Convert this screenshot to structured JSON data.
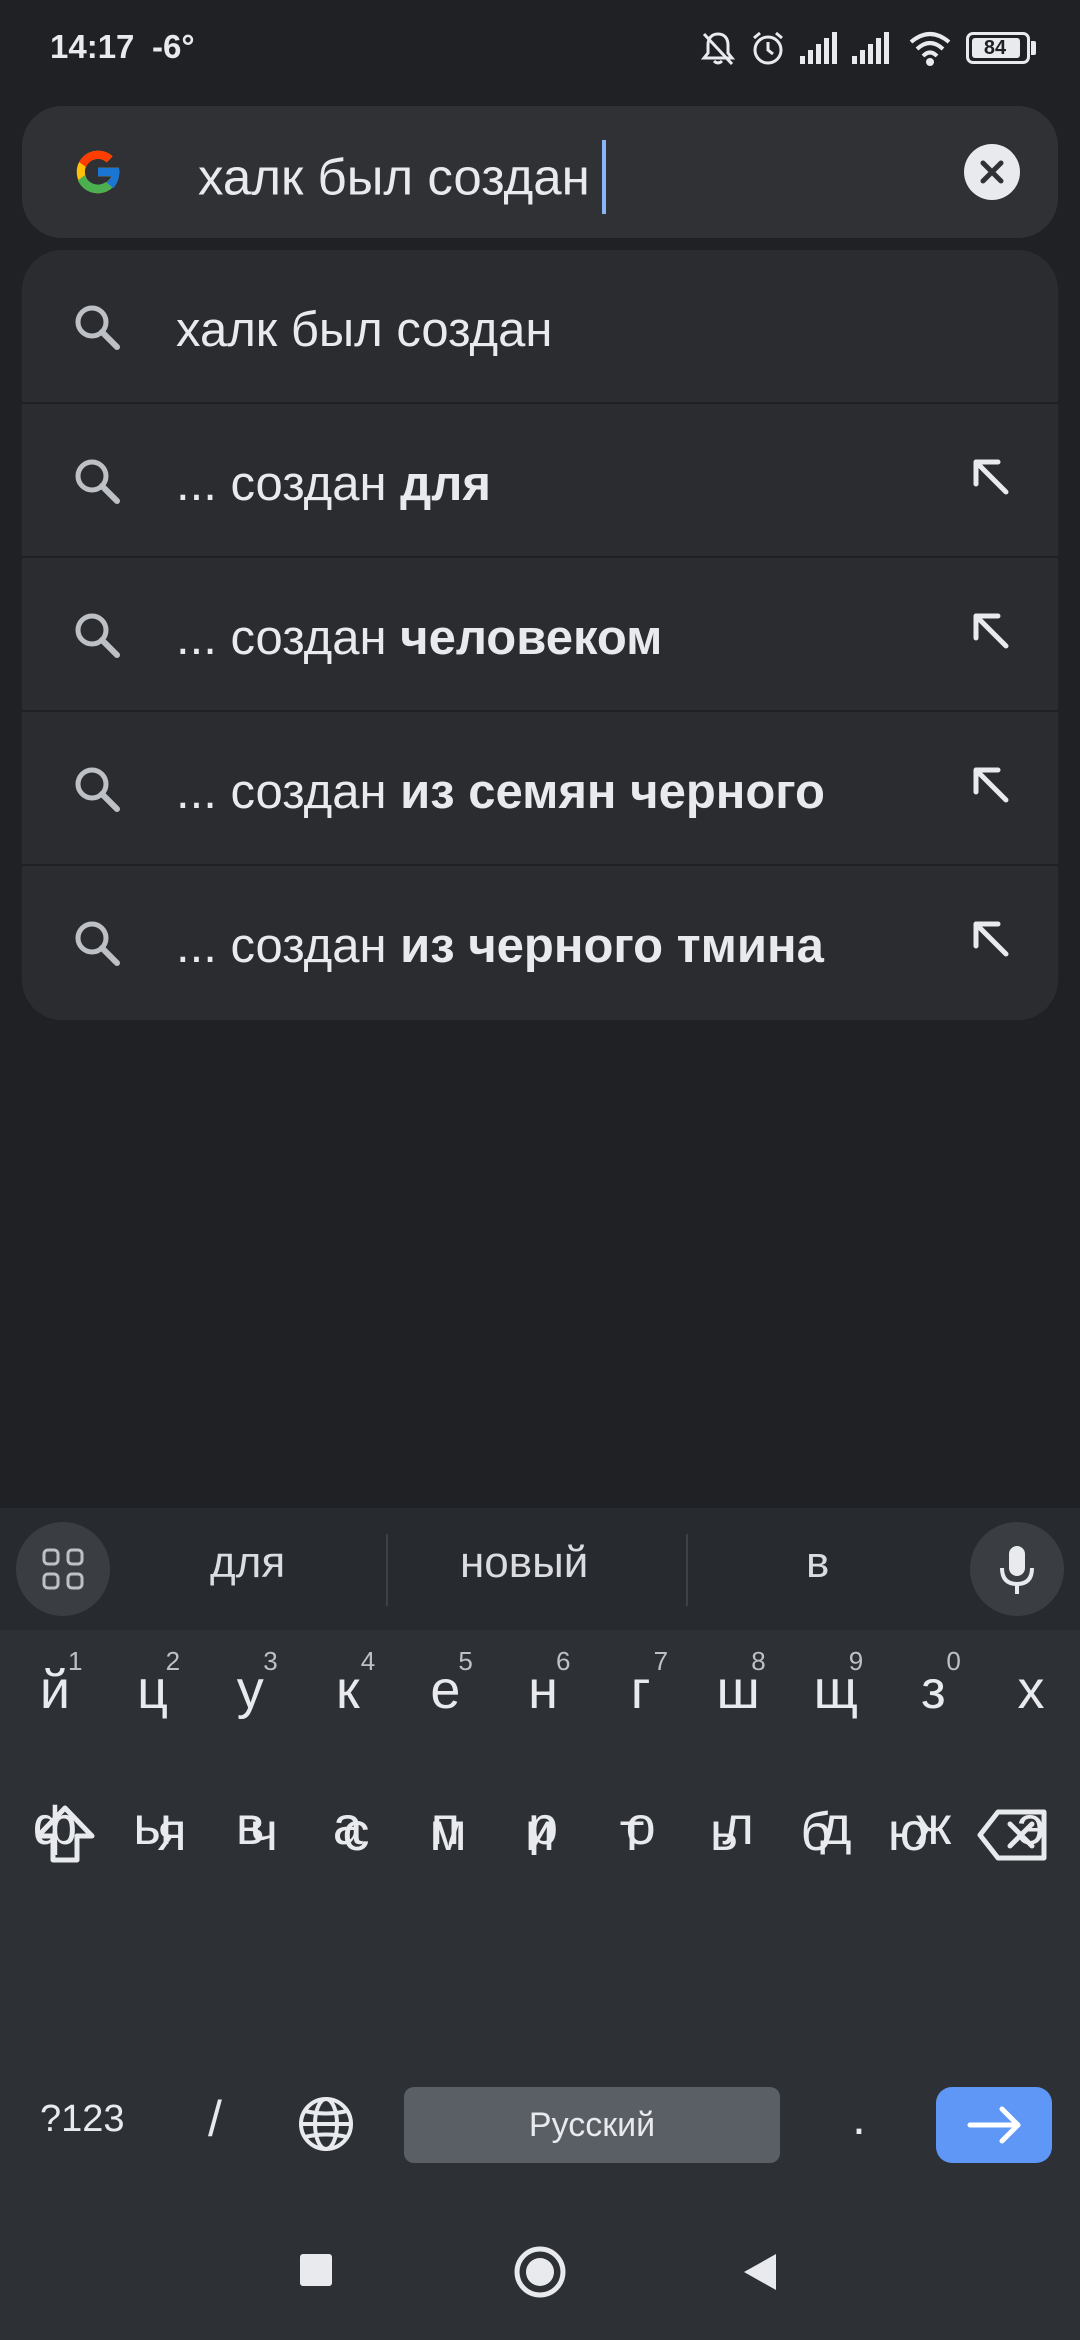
{
  "status_bar": {
    "time": "14:17",
    "temperature": "-6°",
    "battery": "84"
  },
  "search": {
    "query": "халк был создан",
    "logo_icon": "google-g-icon",
    "clear_icon": "close-icon"
  },
  "suggestions": [
    {
      "prefix": "халк был создан",
      "bold": ""
    },
    {
      "prefix": "... создан ",
      "bold": "для"
    },
    {
      "prefix": "... создан ",
      "bold": "человеком"
    },
    {
      "prefix": "... создан ",
      "bold": "из семян черного"
    },
    {
      "prefix": "... создан ",
      "bold": "из черного тмина"
    }
  ],
  "keyboard": {
    "word_suggestions": [
      "для",
      "новый",
      "в"
    ],
    "row1": [
      {
        "key": "й",
        "num": "1"
      },
      {
        "key": "ц",
        "num": "2"
      },
      {
        "key": "у",
        "num": "3"
      },
      {
        "key": "к",
        "num": "4"
      },
      {
        "key": "е",
        "num": "5"
      },
      {
        "key": "н",
        "num": "6"
      },
      {
        "key": "г",
        "num": "7"
      },
      {
        "key": "ш",
        "num": "8"
      },
      {
        "key": "щ",
        "num": "9"
      },
      {
        "key": "з",
        "num": "0"
      },
      {
        "key": "х",
        "num": ""
      }
    ],
    "row2": [
      "ф",
      "ы",
      "в",
      "а",
      "п",
      "р",
      "о",
      "л",
      "д",
      "ж",
      "э"
    ],
    "row3": [
      "я",
      "ч",
      "с",
      "м",
      "и",
      "т",
      "ь",
      "б",
      "ю"
    ],
    "symbols_label": "?123",
    "slash_label": "/",
    "space_label": "Русский",
    "period_label": ".",
    "accent_color": "#5e97f6"
  },
  "colors": {
    "background": "#202124",
    "panel": "#303134",
    "keyboard": "#2d3135"
  }
}
